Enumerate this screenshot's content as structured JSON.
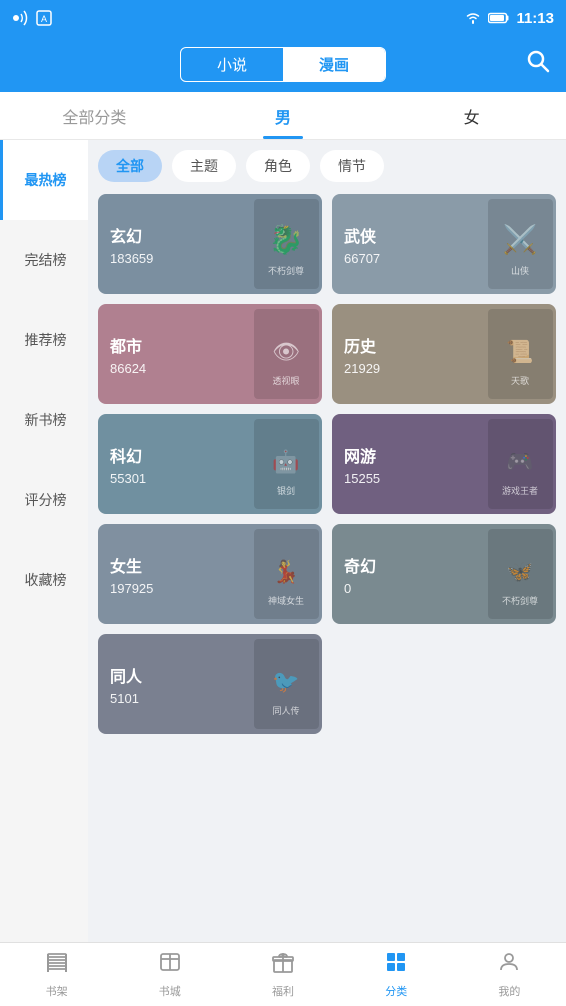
{
  "statusBar": {
    "time": "11:13",
    "icons": [
      "signal",
      "wifi",
      "battery"
    ]
  },
  "topNav": {
    "tabs": [
      {
        "id": "novel",
        "label": "小说",
        "active": false
      },
      {
        "id": "comic",
        "label": "漫画",
        "active": true
      }
    ],
    "searchLabel": "搜索"
  },
  "filterTabs": [
    {
      "id": "all",
      "label": "全部分类",
      "active": false
    },
    {
      "id": "male",
      "label": "男",
      "active": true
    },
    {
      "id": "female",
      "label": "女",
      "active": false
    }
  ],
  "sidebar": {
    "items": [
      {
        "id": "hottest",
        "label": "最热榜",
        "active": true
      },
      {
        "id": "complete",
        "label": "完结榜",
        "active": false
      },
      {
        "id": "recommend",
        "label": "推荐榜",
        "active": false
      },
      {
        "id": "newbook",
        "label": "新书榜",
        "active": false
      },
      {
        "id": "score",
        "label": "评分榜",
        "active": false
      },
      {
        "id": "collect",
        "label": "收藏榜",
        "active": false
      }
    ]
  },
  "categoryPills": [
    {
      "id": "all",
      "label": "全部",
      "active": true
    },
    {
      "id": "theme",
      "label": "主题",
      "active": false
    },
    {
      "id": "role",
      "label": "角色",
      "active": false
    },
    {
      "id": "scene",
      "label": "情节",
      "active": false
    }
  ],
  "categoryCards": [
    {
      "id": "xuanhuan",
      "title": "玄幻",
      "count": "183659",
      "colorClass": "card-xuanhuan",
      "emoji": "🐉"
    },
    {
      "id": "wuxia",
      "title": "武侠",
      "count": "66707",
      "colorClass": "card-wuxia",
      "emoji": "⚔️"
    },
    {
      "id": "dushi",
      "title": "都市",
      "count": "86624",
      "colorClass": "card-dushi",
      "emoji": "👁️"
    },
    {
      "id": "lishi",
      "title": "历史",
      "count": "21929",
      "colorClass": "card-lishi",
      "emoji": "📜"
    },
    {
      "id": "kehuan",
      "title": "科幻",
      "count": "55301",
      "colorClass": "card-kehuan",
      "emoji": "🤖"
    },
    {
      "id": "wangyou",
      "title": "网游",
      "count": "15255",
      "colorClass": "card-wangyou",
      "emoji": "🎮"
    },
    {
      "id": "nvsheng",
      "title": "女生",
      "count": "197925",
      "colorClass": "card-nvsheng",
      "emoji": "💃"
    },
    {
      "id": "qihuan",
      "title": "奇幻",
      "count": "0",
      "colorClass": "card-qihuan",
      "emoji": "🦋"
    },
    {
      "id": "tongren",
      "title": "同人",
      "count": "5101",
      "colorClass": "card-tongren",
      "emoji": "🐦"
    }
  ],
  "bottomNav": {
    "items": [
      {
        "id": "bookshelf",
        "label": "书架",
        "active": false,
        "icon": "bookshelf"
      },
      {
        "id": "bookstore",
        "label": "书城",
        "active": false,
        "icon": "bookstore"
      },
      {
        "id": "welfare",
        "label": "福利",
        "active": false,
        "icon": "gift"
      },
      {
        "id": "category",
        "label": "分类",
        "active": true,
        "icon": "category"
      },
      {
        "id": "mine",
        "label": "我的",
        "active": false,
        "icon": "mine"
      }
    ]
  }
}
